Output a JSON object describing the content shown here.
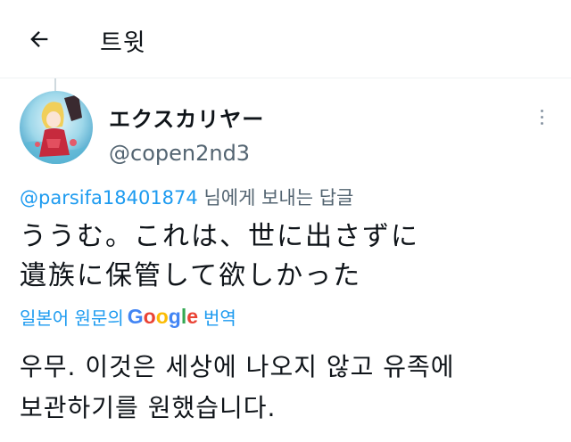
{
  "header": {
    "title": "트윗",
    "back_icon": "arrow-left-icon"
  },
  "author": {
    "display_name": "エクスカリヤー",
    "handle": "@copen2nd3",
    "avatar_icon": "avatar-image"
  },
  "more_icon": "more-vertical-icon",
  "reply": {
    "mention": "@parsifa18401874",
    "suffix": " 님에게 보내는 답글"
  },
  "tweet": {
    "lines": [
      "ううむ。これは、世に出さずに",
      "遺族に保管して欲しかった"
    ]
  },
  "translation": {
    "prefix": "일본어 원문의",
    "google": [
      "G",
      "o",
      "o",
      "g",
      "l",
      "e"
    ],
    "suffix": "번역",
    "colors": [
      "#4285f4",
      "#ea4335",
      "#fbbc05",
      "#4285f4",
      "#34a853",
      "#ea4335"
    ]
  },
  "translated": {
    "lines": [
      "우무. 이것은 세상에 나오지 않고 유족에",
      "보관하기를 원했습니다."
    ]
  },
  "colors": {
    "link": "#1d9bf0",
    "secondary": "#536471",
    "text": "#0f1419"
  }
}
